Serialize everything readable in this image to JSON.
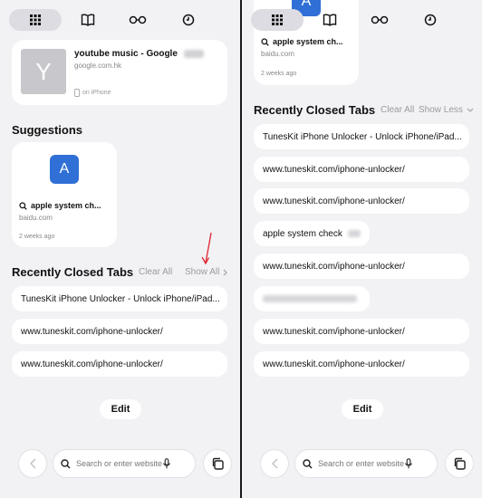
{
  "left": {
    "shared_card": {
      "avatar_letter": "Y",
      "title": "youtube music - Google",
      "domain": "google.com.hk",
      "device": "on iPhone"
    },
    "suggestions": {
      "title": "Suggestions",
      "item": {
        "letter": "A",
        "title": "apple system ch...",
        "domain": "baidu.com",
        "time": "2 weeks ago"
      }
    },
    "recently_closed": {
      "title": "Recently Closed Tabs",
      "clear_all": "Clear All",
      "show_all": "Show All",
      "tabs": [
        "TunesKit iPhone Unlocker - Unlock iPhone/iPad...",
        "www.tuneskit.com/iphone-unlocker/",
        "www.tuneskit.com/iphone-unlocker/"
      ]
    },
    "edit_label": "Edit"
  },
  "right": {
    "suggestion": {
      "letter": "A",
      "title": "apple system ch...",
      "domain": "baidu.com",
      "time": "2 weeks ago"
    },
    "recently_closed": {
      "title": "Recently Closed Tabs",
      "clear_all": "Clear All",
      "show_less": "Show Less",
      "tabs": [
        {
          "text": "TunesKit iPhone Unlocker - Unlock iPhone/iPad..."
        },
        {
          "text": "www.tuneskit.com/iphone-unlocker/"
        },
        {
          "text": "www.tuneskit.com/iphone-unlocker/"
        },
        {
          "text": "apple system check"
        },
        {
          "text": "www.tuneskit.com/iphone-unlocker/"
        },
        {
          "text": ""
        },
        {
          "text": "www.tuneskit.com/iphone-unlocker/"
        },
        {
          "text": "www.tuneskit.com/iphone-unlocker/"
        }
      ]
    },
    "edit_label": "Edit"
  },
  "search": {
    "placeholder": "Search or enter website"
  },
  "icons": {
    "grid": "grid-icon",
    "book": "bookmarks-icon",
    "glasses": "reading-list-icon",
    "clock": "history-icon",
    "back": "chevron-left-icon",
    "search": "search-icon",
    "mic": "microphone-icon",
    "tabs": "tabs-icon",
    "phone": "phone-icon",
    "arrow": "red-arrow-annotation"
  },
  "colors": {
    "accent": "#2f6fd6",
    "annotation": "#e0252e",
    "background": "#f2f2f5"
  }
}
